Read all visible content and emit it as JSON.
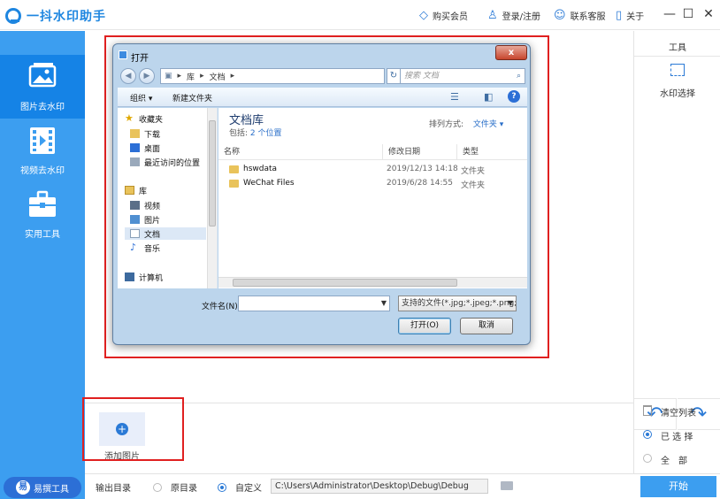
{
  "app": {
    "name": "一抖水印助手",
    "menu": {
      "buy": "购买会员",
      "login": "登录/注册",
      "support": "联系客服",
      "about": "关于"
    },
    "window": {
      "minimize": "—",
      "maximize": "☐",
      "close": "✕"
    },
    "accent_color": "#3c9ef0"
  },
  "sidebar": {
    "items": [
      {
        "label": "图片去水印",
        "icon": "image-icon",
        "active": true
      },
      {
        "label": "视频去水印",
        "icon": "film-icon",
        "active": false
      },
      {
        "label": "实用工具",
        "icon": "toolbox-icon",
        "active": false
      }
    ],
    "chip": {
      "label": "易撰工具",
      "badge": "易"
    }
  },
  "tools_panel": {
    "title": "工具",
    "watermark_select": "水印选择",
    "undo": "↶",
    "redo": "↷",
    "clear_list": "清空列表",
    "selected": "已 选 择",
    "all": "全　部",
    "selected_option": "selected"
  },
  "strip": {
    "add_label": "添加图片",
    "plus": "+"
  },
  "bottom": {
    "output_label": "输出目录",
    "original_dir": "原目录",
    "custom": "自定义",
    "output_mode": "custom",
    "path": "C:\\Users\\Administrator\\Desktop\\Debug\\Debug",
    "start": "开始"
  },
  "dialog": {
    "title": "打开",
    "close": "x",
    "address": [
      "库",
      "文档"
    ],
    "search_placeholder": "搜索 文档",
    "toolbar": {
      "organize": "组织 ▾",
      "new_folder": "新建文件夹"
    },
    "help": "?",
    "tree": [
      {
        "label": "收藏夹",
        "icon": "star-icon",
        "indent": 0
      },
      {
        "label": "下载",
        "icon": "download-folder-icon",
        "indent": 1
      },
      {
        "label": "桌面",
        "icon": "desktop-icon",
        "indent": 1
      },
      {
        "label": "最近访问的位置",
        "icon": "recent-places-icon",
        "indent": 1
      },
      {
        "label": "库",
        "icon": "library-icon",
        "indent": 0
      },
      {
        "label": "视频",
        "icon": "video-library-icon",
        "indent": 1
      },
      {
        "label": "图片",
        "icon": "picture-library-icon",
        "indent": 1
      },
      {
        "label": "文档",
        "icon": "document-library-icon",
        "indent": 1,
        "selected": true
      },
      {
        "label": "音乐",
        "icon": "music-library-icon",
        "indent": 1
      },
      {
        "label": "计算机",
        "icon": "computer-icon",
        "indent": 0
      }
    ],
    "library": {
      "title": "文档库",
      "includes_label": "包括:",
      "includes_link": "2 个位置",
      "arrange_label": "排列方式:",
      "arrange_value": "文件夹 ▾"
    },
    "columns": [
      "名称",
      "修改日期",
      "类型"
    ],
    "files": [
      {
        "name": "hswdata",
        "modified": "2019/12/13 14:18",
        "type": "文件夹"
      },
      {
        "name": "WeChat Files",
        "modified": "2019/6/28 14:55",
        "type": "文件夹"
      }
    ],
    "filename_label": "文件名(N):",
    "filename_value": "",
    "filter": "支持的文件(*.jpg;*.jpeg;*.png;",
    "open": "打开(O)",
    "cancel": "取消"
  }
}
